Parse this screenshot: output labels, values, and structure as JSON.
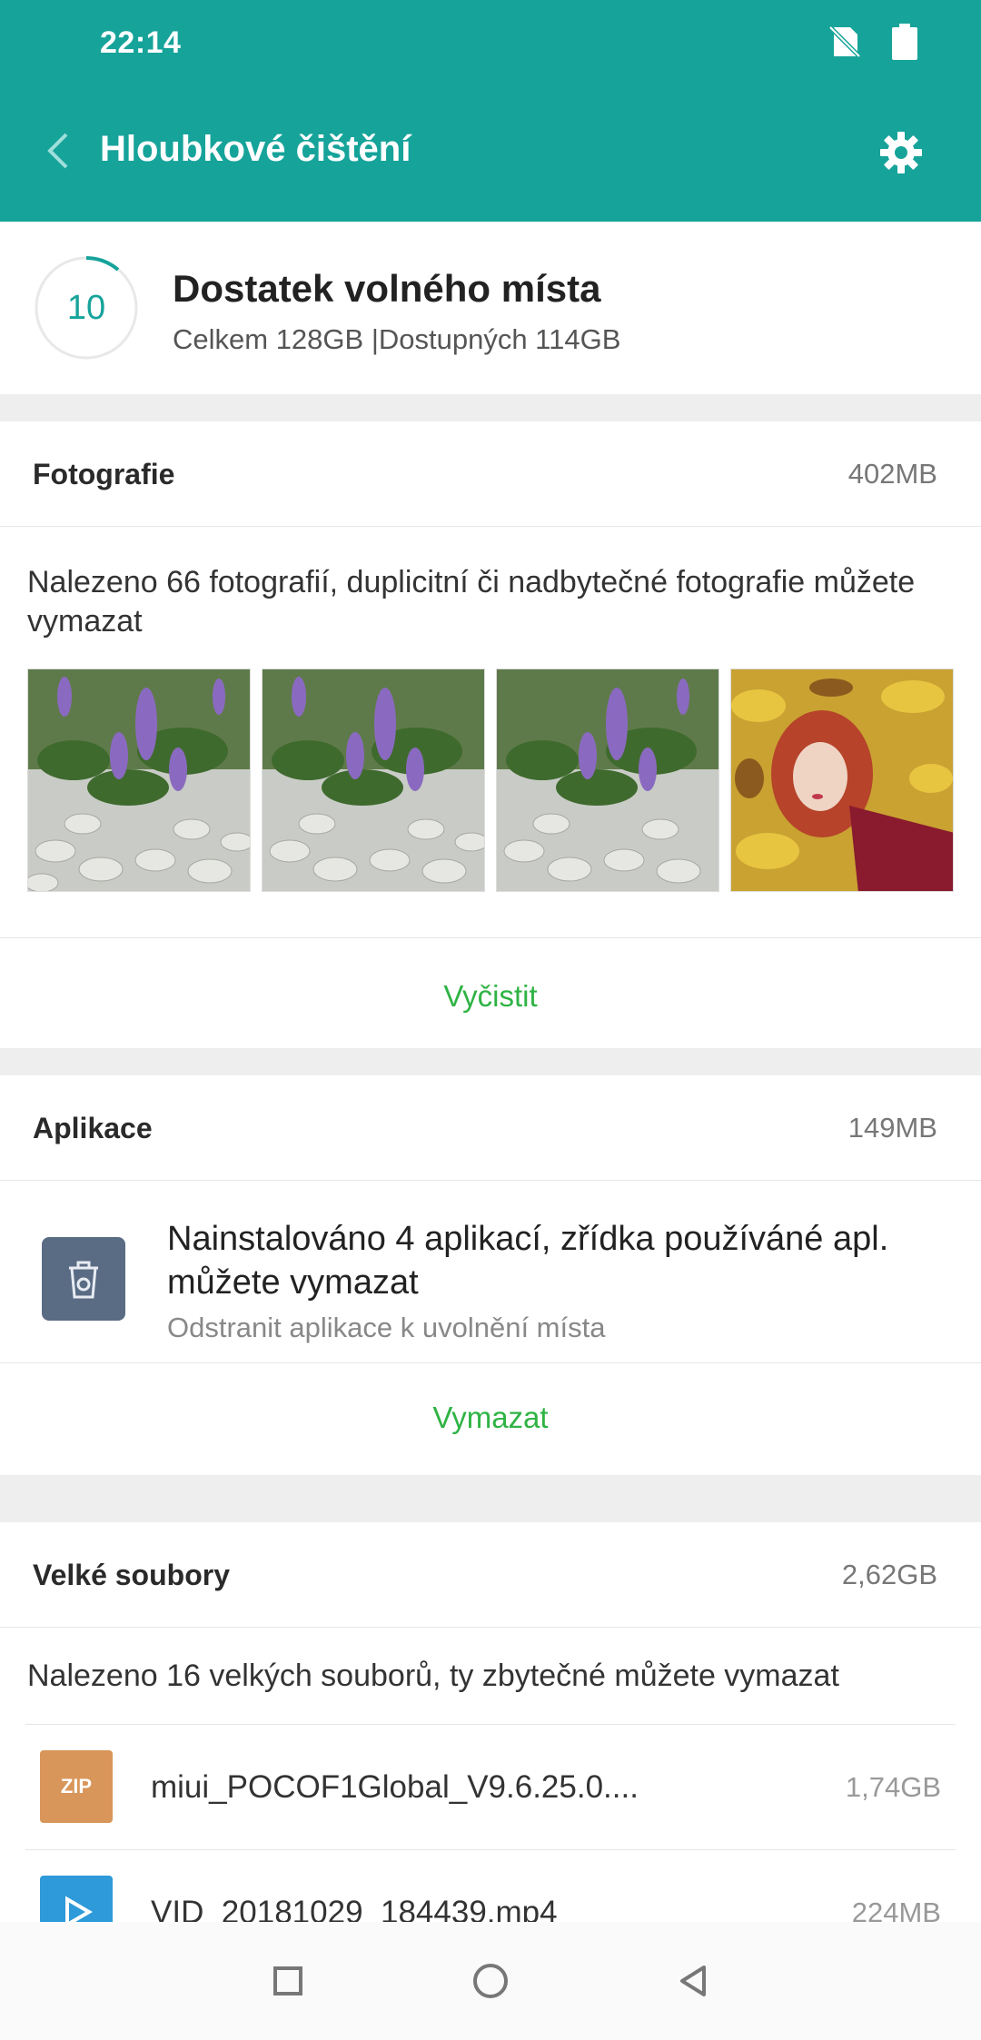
{
  "status": {
    "time": "22:14",
    "no_sim_icon": "no-sim-icon",
    "battery_icon": "battery-icon"
  },
  "header": {
    "title": "Hloubkové čištění",
    "back_icon": "chevron-left-icon",
    "settings_icon": "gear-icon"
  },
  "summary": {
    "score": "10",
    "title": "Dostatek volného místa",
    "subtitle": "Celkem 128GB |Dostupných 114GB"
  },
  "photos": {
    "title": "Fotografie",
    "size": "402MB",
    "description": "Nalezeno 66 fotografií, duplicitní či nadbytečné fotografie můžete vymazat",
    "items": [
      "flower-photo-1",
      "flower-photo-2",
      "flower-photo-3",
      "portrait-leaves-photo"
    ],
    "action": "Vyčistit"
  },
  "apps": {
    "title": "Aplikace",
    "size": "149MB",
    "description": "Nainstalováno 4 aplikací, zřídka používáné apl. můžete vymazat",
    "subtitle": "Odstranit aplikace k uvolnění místa",
    "icon": "trash-app-icon",
    "action": "Vymazat"
  },
  "large_files": {
    "title": "Velké soubory",
    "size": "2,62GB",
    "description": "Nalezeno 16 velkých souborů, ty zbytečné můžete vymazat",
    "files": [
      {
        "icon_label": "ZIP",
        "name": "miui_POCOF1Global_V9.6.25.0....",
        "size": "1,74GB"
      },
      {
        "icon_label": "",
        "name": "VID_20181029_184439.mp4",
        "size": "224MB"
      }
    ]
  },
  "colors": {
    "accent": "#16a39a",
    "action_green": "#2fb344",
    "zip_icon": "#d9965a",
    "video_icon": "#2e9ad9",
    "app_icon_bg": "#5a6b84"
  },
  "navbar": {
    "recents_icon": "square-icon",
    "home_icon": "circle-icon",
    "back_icon": "triangle-back-icon"
  }
}
